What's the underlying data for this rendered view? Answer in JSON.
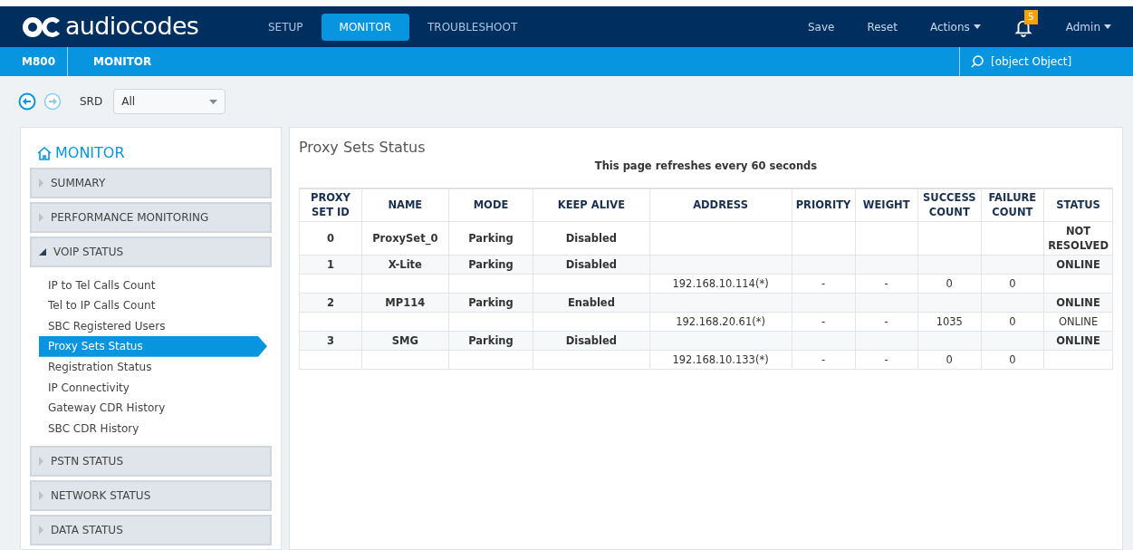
{
  "header": {
    "logo": "audiocodes",
    "tabs": [
      {
        "label": "SETUP",
        "selected": false
      },
      {
        "label": "MONITOR",
        "selected": true
      },
      {
        "label": "TROUBLESHOOT",
        "selected": false
      }
    ],
    "actions": [
      {
        "label": "Save",
        "kind": "plain"
      },
      {
        "label": "Reset",
        "kind": "plain"
      },
      {
        "label": "Actions",
        "kind": "menu"
      }
    ],
    "notifications": "5",
    "user": "Admin"
  },
  "subbar": {
    "device": "M800",
    "section": "MONITOR",
    "search": "[object Object]"
  },
  "toolbar": {
    "srd_label": "SRD",
    "srd_value": "All"
  },
  "sidebar": {
    "title": "MONITOR",
    "sections": [
      {
        "label": "SUMMARY",
        "expanded": false
      },
      {
        "label": "PERFORMANCE MONITORING",
        "expanded": false
      },
      {
        "label": "VOIP STATUS",
        "expanded": true,
        "children": [
          {
            "label": "IP to Tel Calls Count",
            "selected": false
          },
          {
            "label": "Tel to IP Calls Count",
            "selected": false
          },
          {
            "label": "SBC Registered Users",
            "selected": false
          },
          {
            "label": "Proxy Sets Status",
            "selected": true
          },
          {
            "label": "Registration Status",
            "selected": false
          },
          {
            "label": "IP Connectivity",
            "selected": false
          },
          {
            "label": "Gateway CDR History",
            "selected": false
          },
          {
            "label": "SBC CDR History",
            "selected": false
          }
        ]
      },
      {
        "label": "PSTN STATUS",
        "expanded": false
      },
      {
        "label": "NETWORK STATUS",
        "expanded": false
      },
      {
        "label": "DATA STATUS",
        "expanded": false
      }
    ]
  },
  "main": {
    "title": "Proxy Sets Status",
    "note": "This page refreshes every 60 seconds",
    "table": {
      "columns": [
        "PROXY SET ID",
        "NAME",
        "MODE",
        "KEEP ALIVE",
        "ADDRESS",
        "PRIORITY",
        "WEIGHT",
        "SUCCESS COUNT",
        "FAILURE COUNT",
        "STATUS"
      ],
      "rows": [
        {
          "kind": "set",
          "cells": [
            "0",
            "ProxySet_0",
            "Parking",
            "Disabled",
            "",
            "",
            "",
            "",
            "",
            "NOT RESOLVED"
          ]
        },
        {
          "kind": "set",
          "cells": [
            "1",
            "X-Lite",
            "Parking",
            "Disabled",
            "",
            "",
            "",
            "",
            "",
            "ONLINE"
          ]
        },
        {
          "kind": "address",
          "cells": [
            "",
            "",
            "",
            "",
            "192.168.10.114(*)",
            "-",
            "-",
            "0",
            "0",
            ""
          ]
        },
        {
          "kind": "set",
          "cells": [
            "2",
            "MP114",
            "Parking",
            "Enabled",
            "",
            "",
            "",
            "",
            "",
            "ONLINE"
          ]
        },
        {
          "kind": "address",
          "cells": [
            "",
            "",
            "",
            "",
            "192.168.20.61(*)",
            "-",
            "-",
            "1035",
            "0",
            "ONLINE"
          ]
        },
        {
          "kind": "set",
          "cells": [
            "3",
            "SMG",
            "Parking",
            "Disabled",
            "",
            "",
            "",
            "",
            "",
            "ONLINE"
          ]
        },
        {
          "kind": "address",
          "cells": [
            "",
            "",
            "",
            "",
            "192.168.10.133(*)",
            "-",
            "-",
            "0",
            "0",
            ""
          ]
        }
      ]
    }
  }
}
